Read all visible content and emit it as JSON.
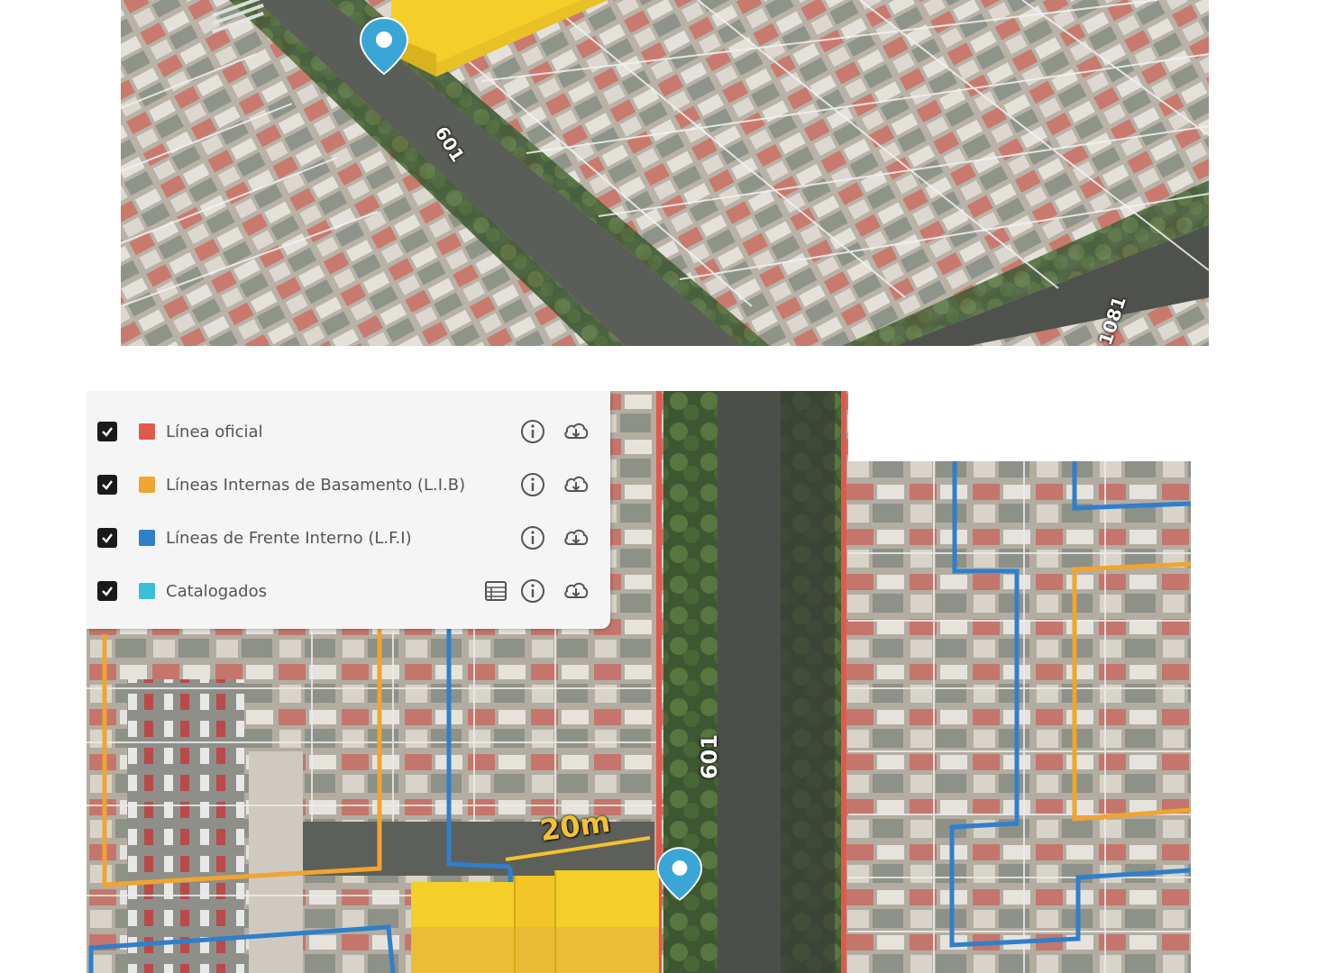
{
  "top_map": {
    "road_labels": [
      "601",
      "1081"
    ],
    "marker_icon": "location-pin-icon"
  },
  "bottom_map": {
    "road_label": "601",
    "scale_label": "20m",
    "marker_icon": "location-pin-icon"
  },
  "layer_panel": {
    "layers": [
      {
        "label": "Línea oficial",
        "color": "#e05a4b",
        "checked": true,
        "icons": [
          "info-icon",
          "cloud-download-icon"
        ]
      },
      {
        "label": "Líneas Internas de Basamento (L.I.B)",
        "color": "#f0a431",
        "checked": true,
        "icons": [
          "info-icon",
          "cloud-download-icon"
        ]
      },
      {
        "label": "Líneas de Frente Interno (L.F.I)",
        "color": "#2f7fcb",
        "checked": true,
        "icons": [
          "info-icon",
          "cloud-download-icon"
        ]
      },
      {
        "label": "Catalogados",
        "color": "#3bbfd9",
        "checked": true,
        "icons": [
          "table-icon",
          "info-icon",
          "cloud-download-icon"
        ]
      }
    ]
  },
  "colors": {
    "official_line": "#e05a4b",
    "basement_line": "#f0a431",
    "internal_front_line": "#2f7fcb",
    "catalogued": "#3bbfd9",
    "building_volume": "#f4cf2a",
    "marker": "#3aa6d8"
  }
}
